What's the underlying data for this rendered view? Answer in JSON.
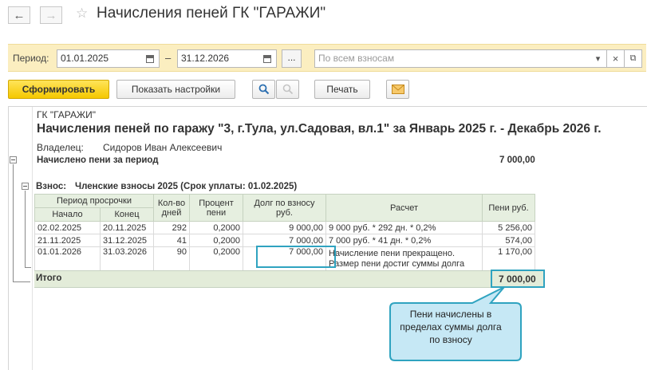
{
  "header": {
    "title": "Начисления пеней ГК \"ГАРАЖИ\"",
    "back_icon": "←",
    "forward_icon": "→",
    "star_icon": "☆"
  },
  "filter": {
    "period_label": "Период:",
    "date_from": "01.01.2025",
    "dash": "–",
    "date_to": "31.12.2026",
    "dots_label": "...",
    "contribution_placeholder": "По всем взносам",
    "dropdown_icon": "▾",
    "clear_icon": "×",
    "open_icon": "⧉"
  },
  "toolbar": {
    "generate_label": "Сформировать",
    "settings_label": "Показать настройки",
    "print_label": "Печать"
  },
  "report": {
    "org": "ГК \"ГАРАЖИ\"",
    "title": "Начисления пеней по гаражу \"3, г.Тула, ул.Садовая, вл.1\"  за Январь 2025 г. - Декабрь 2026 г.",
    "owner_label": "Владелец:",
    "owner_value": "Сидоров Иван Алексеевич",
    "accrued_label": "Начислено пени за период",
    "accrued_value": "7 000,00",
    "contribution_label": "Взнос:",
    "contribution_value": "Членские взносы 2025 (Срок уплаты: 01.02.2025)",
    "columns": {
      "period": "Период просрочки",
      "start": "Начало",
      "end": "Конец",
      "days": "Кол-во дней",
      "percent": "Процент пени",
      "debt": "Долг по взносу руб.",
      "calc": "Расчет",
      "penalty": "Пени руб."
    },
    "rows": [
      {
        "start": "02.02.2025",
        "end": "20.11.2025",
        "days": "292",
        "percent": "0,2000",
        "debt": "9 000,00",
        "calc": "9 000 руб. * 292 дн. * 0,2%",
        "calc2": "",
        "penalty": "5 256,00"
      },
      {
        "start": "21.11.2025",
        "end": "31.12.2025",
        "days": "41",
        "percent": "0,2000",
        "debt": "7 000,00",
        "calc": "7 000 руб. * 41 дн. * 0,2%",
        "calc2": "",
        "penalty": "574,00"
      },
      {
        "start": "01.01.2026",
        "end": "31.03.2026",
        "days": "90",
        "percent": "0,2000",
        "debt": "7 000,00",
        "calc": "Начисление пени прекращено.",
        "calc2": "Размер пени достиг суммы долга",
        "penalty": "1 170,00"
      }
    ],
    "total_label": "Итого",
    "total_value": "7 000,00"
  },
  "callout": {
    "line1": "Пени начислены в",
    "line2": "пределах суммы долга",
    "line3": "по взносу"
  },
  "colors": {
    "filter_bg": "#fbeec0",
    "primary_button": "#f5c800",
    "header_row": "#e6efe0",
    "highlight": "#2fa3c0",
    "callout_fill": "#c6e8f5"
  }
}
